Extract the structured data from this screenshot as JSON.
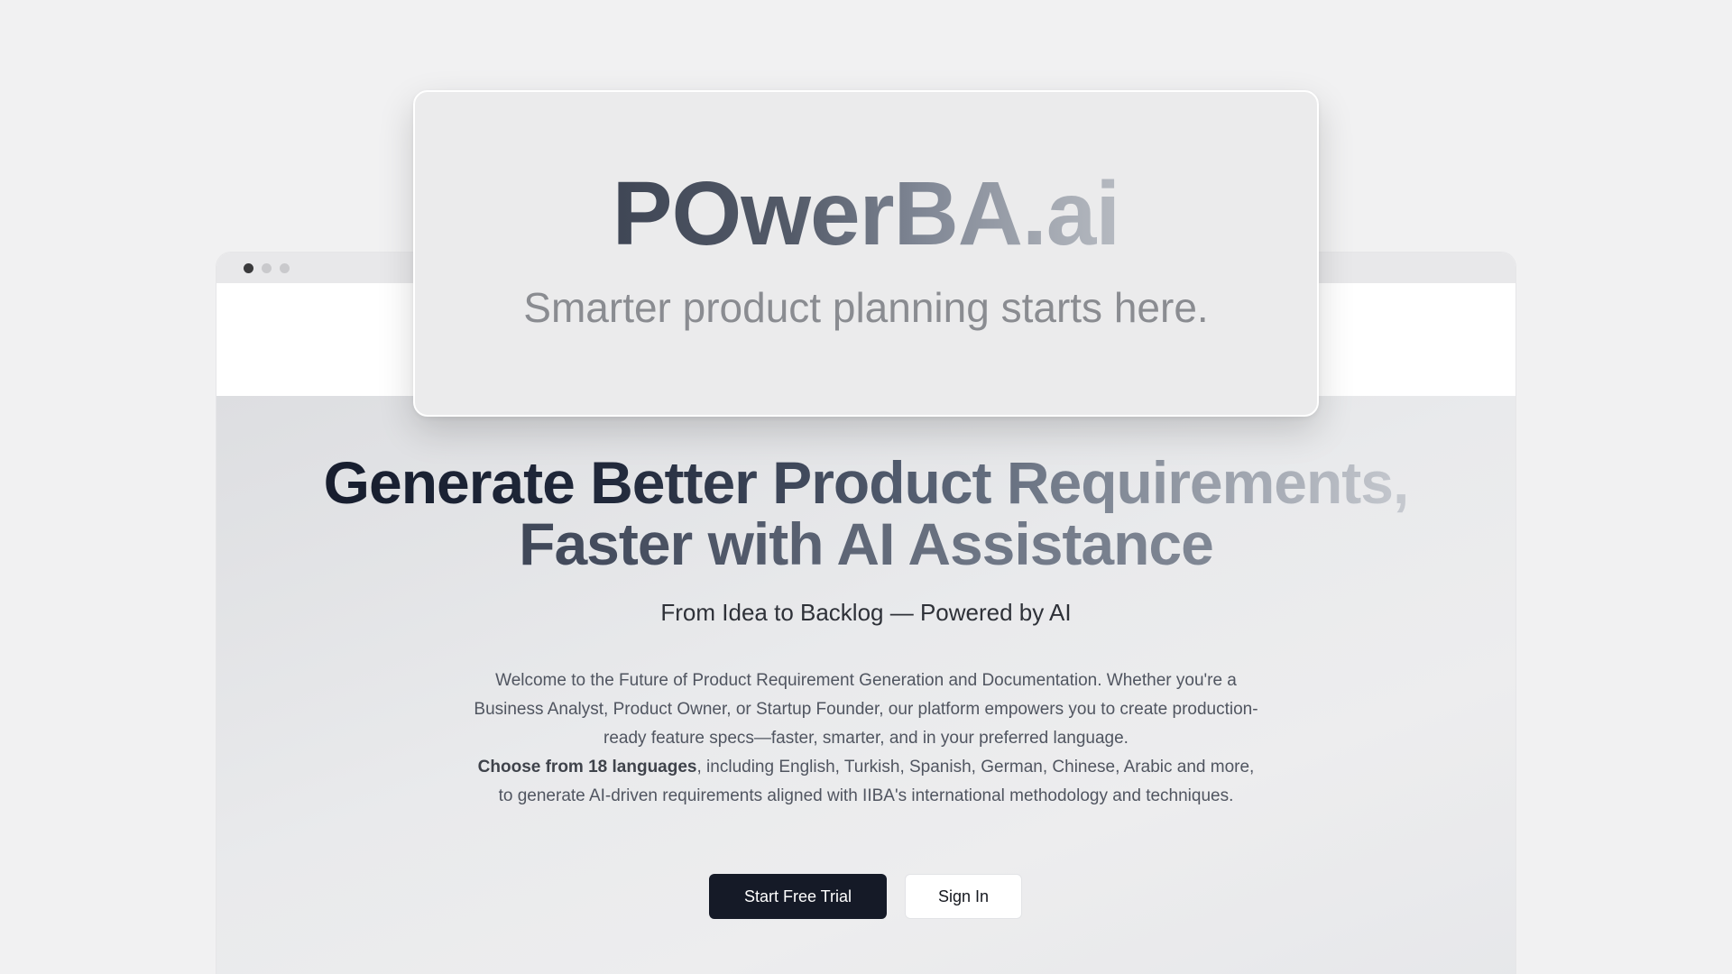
{
  "browser": {
    "window_dots": [
      "close",
      "minimize",
      "maximize"
    ]
  },
  "logo_card": {
    "title": "POwerBA.ai",
    "tagline": "Smarter product planning starts here."
  },
  "hero": {
    "title_line1": "Generate Better Product Requirements,",
    "title_line2": "Faster with AI Assistance",
    "subtitle": "From Idea to Backlog — Powered by AI",
    "body_part1": "Welcome to the Future of Product Requirement Generation and Documentation. Whether you're a Business Analyst, Product Owner, or Startup Founder, our platform empowers you to create production-ready feature specs—faster, smarter, and in your preferred language.",
    "body_bold": "Choose from 18 languages",
    "body_part2": ", including English, Turkish, Spanish, German, Chinese, Arabic and more, to generate AI-driven requirements aligned with IIBA's international methodology and techniques."
  },
  "actions": {
    "primary_label": "Start Free Trial",
    "secondary_label": "Sign In"
  },
  "colors": {
    "primary_button": "#151a27",
    "page_background": "#f1f1f2",
    "card_background": "#ebebec"
  }
}
